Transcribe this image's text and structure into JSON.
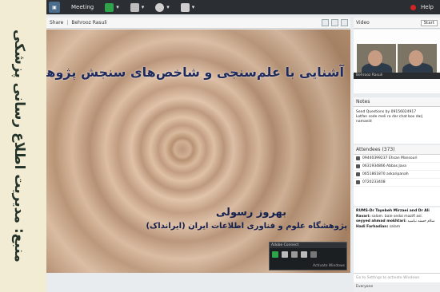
{
  "banner": {
    "text": "منبع: مدیریت اطلاع رسانی پزشکی"
  },
  "menubar": {
    "meeting_label": "Meeting",
    "help_label": "Help",
    "colors": {
      "bg": "#2b2f33",
      "mic": "#2fa34a",
      "cam": "#d8d8d8"
    }
  },
  "share": {
    "header_label": "Share",
    "presenter": "Behrooz Rasuli",
    "slide_title": "آشنایی با علم‌سنجی و شاخص‌های سنجش پژوهش",
    "speaker_name": "بهروز رسولی",
    "institute": "پژوهشگاه علوم و فناوری اطلاعات ایران (ایرانداک)",
    "mini_title": "Adobe Connect",
    "mini_watermark": "Activate Windows"
  },
  "video": {
    "header_label": "Video",
    "start_button": "Start",
    "cam_label": "Behrooz Rasuli"
  },
  "notes": {
    "header_label": "Notes",
    "line1": "Send Questions by 09156024917",
    "line2": "Lotfan code meli ra dar chat box darj namaeid"
  },
  "attendees": {
    "header_label": "Attendees",
    "count": "(373)",
    "rows": [
      "09440399237 Ehsan Mansouri",
      "0631934866 Abbas Java",
      "0651861870 askaripanah",
      "0720233408"
    ]
  },
  "chat": {
    "msg1_name": "RUMS-Dr Tayebeh Mirzaei and Dr Ali Ravari:",
    "msg1_text": "salam. baie sedai mazifi asl.",
    "msg2_name": "seyyed ahmad mokhtari:",
    "msg2_text": "سلام خسته نباشید",
    "msg3_name": "Hadi Farhadian:",
    "msg3_text": "salam",
    "input_placeholder": "Go to Settings to activate Windows",
    "footer": "Everyone"
  }
}
